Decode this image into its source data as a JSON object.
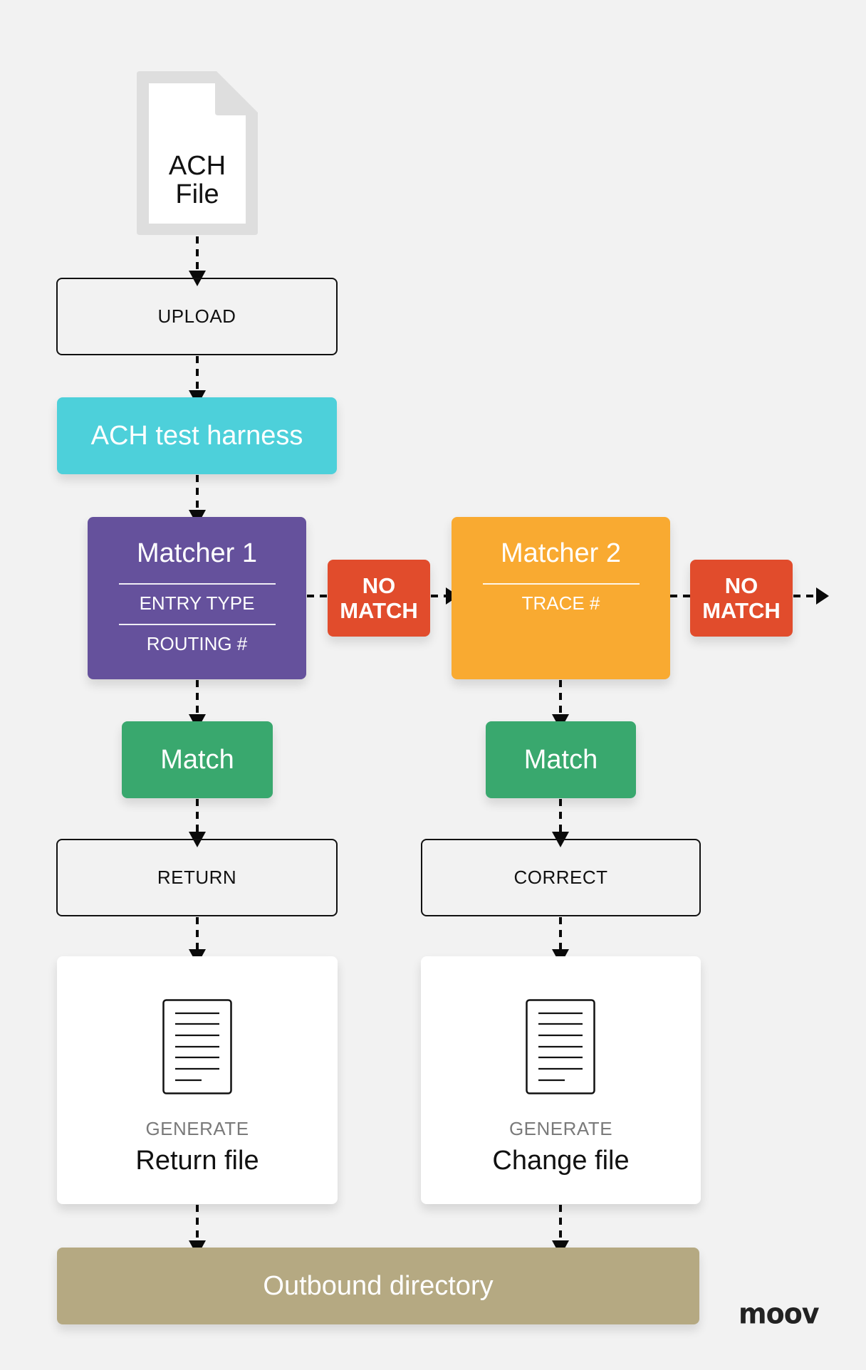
{
  "source_file": {
    "line1": "ACH",
    "line2": "File",
    "icon": "document-icon"
  },
  "steps": {
    "upload": "UPLOAD",
    "harness": "ACH test harness"
  },
  "matcher1": {
    "title": "Matcher 1",
    "criteria": [
      "ENTRY TYPE",
      "ROUTING #"
    ],
    "color": "#65519c"
  },
  "matcher2": {
    "title": "Matcher 2",
    "criteria": [
      "TRACE #"
    ],
    "color": "#f9aa31"
  },
  "no_match": {
    "line1": "NO",
    "line2": "MATCH",
    "color": "#e14c2c"
  },
  "match_label": "Match",
  "left_branch": {
    "action": "RETURN",
    "generate_label": "GENERATE",
    "output_name": "Return file"
  },
  "right_branch": {
    "action": "CORRECT",
    "generate_label": "GENERATE",
    "output_name": "Change file"
  },
  "outbound": "Outbound directory",
  "logo": "moov",
  "colors": {
    "background": "#f2f2f2",
    "harness": "#4dd0da",
    "match": "#39a86e",
    "outbound": "#b5a982"
  }
}
